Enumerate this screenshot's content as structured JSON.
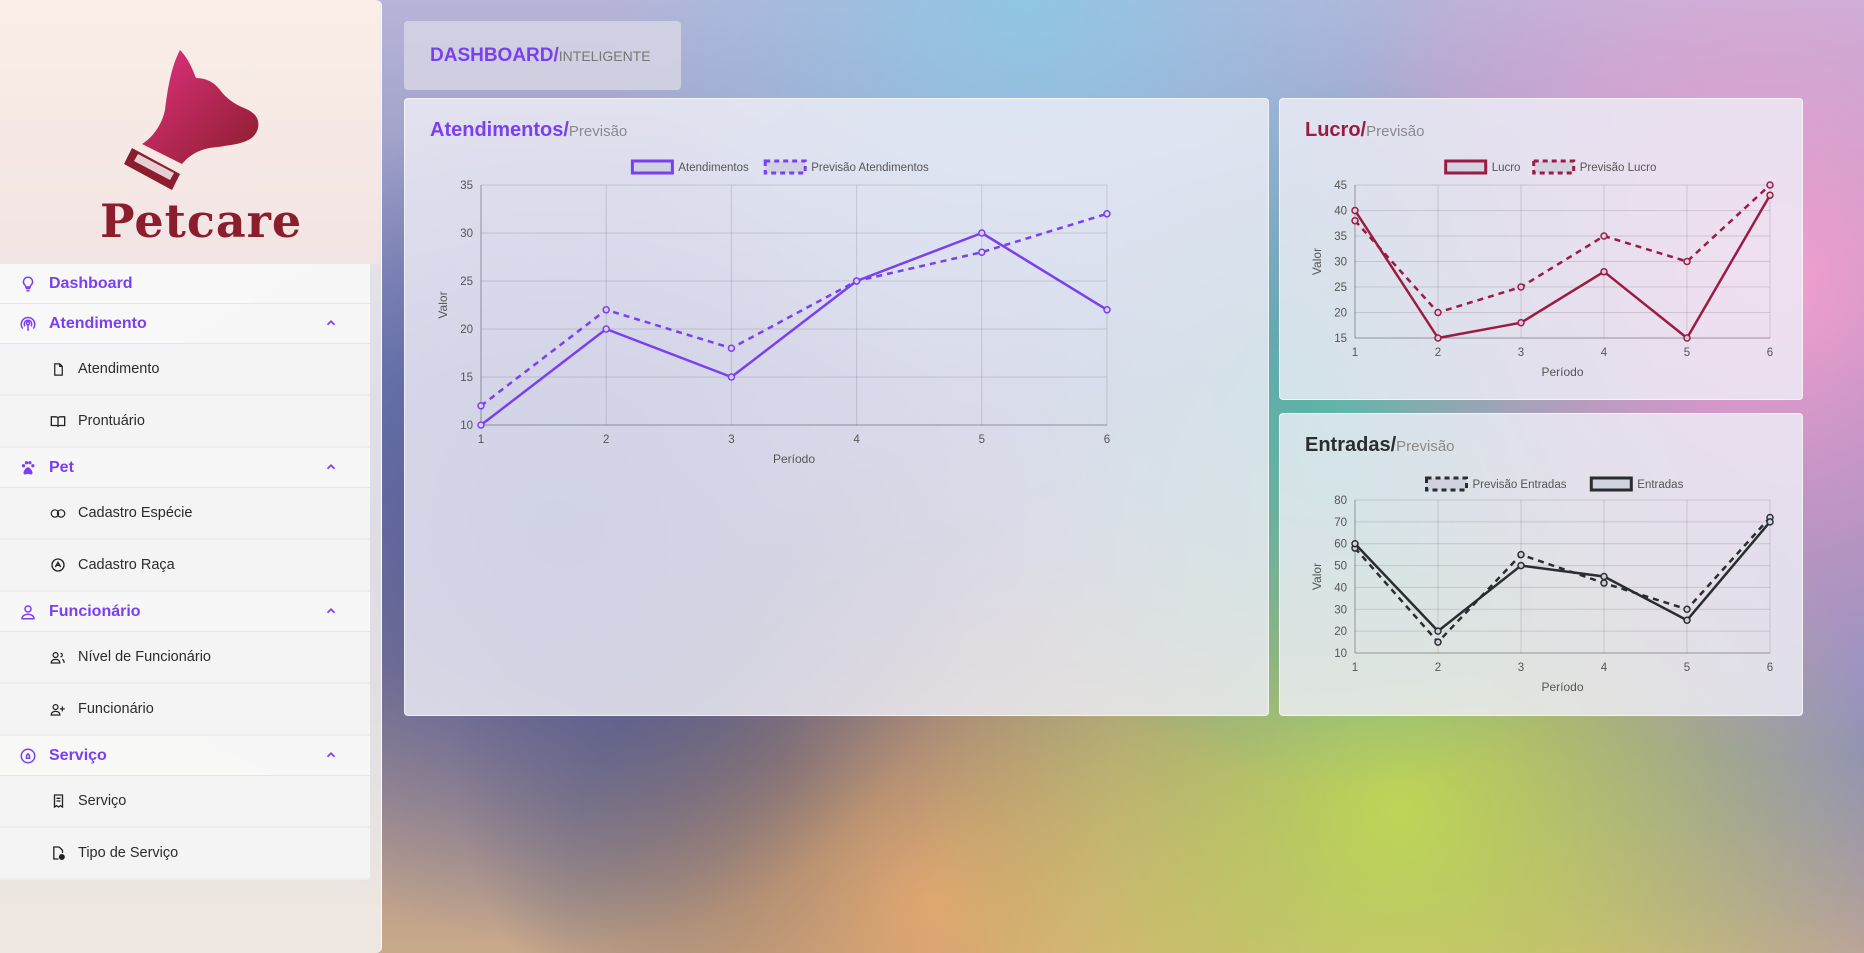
{
  "app": {
    "brand": "Petcare"
  },
  "header": {
    "title_strong": "DASHBOARD/",
    "title_light": "INTELIGENTE"
  },
  "sidebar": {
    "sections": [
      {
        "label": "Dashboard",
        "icon": "lightbulb-icon",
        "expandable": false,
        "items": []
      },
      {
        "label": "Atendimento",
        "icon": "broadcast-icon",
        "expandable": true,
        "items": [
          {
            "label": "Atendimento",
            "icon": "file-icon"
          },
          {
            "label": "Prontuário",
            "icon": "book-icon"
          }
        ]
      },
      {
        "label": "Pet",
        "icon": "paw-icon",
        "expandable": true,
        "items": [
          {
            "label": "Cadastro Espécie",
            "icon": "circles-icon"
          },
          {
            "label": "Cadastro Raça",
            "icon": "badge-icon"
          }
        ]
      },
      {
        "label": "Funcionário",
        "icon": "person-icon",
        "expandable": true,
        "items": [
          {
            "label": "Nível de Funcionário",
            "icon": "people-icon"
          },
          {
            "label": "Funcionário",
            "icon": "person-add-icon"
          }
        ]
      },
      {
        "label": "Serviço",
        "icon": "bell-circle-icon",
        "expandable": true,
        "items": [
          {
            "label": "Serviço",
            "icon": "receipt-icon"
          },
          {
            "label": "Tipo de Serviço",
            "icon": "file-gear-icon"
          }
        ]
      }
    ]
  },
  "colors": {
    "accent_purple": "#7b3ff2",
    "accent_crimson": "#9b1b45",
    "dark": "#2a2d30"
  },
  "cards": {
    "atendimentos": {
      "title_strong": "Atendimentos/",
      "title_light": "Previsão"
    },
    "lucro": {
      "title_strong": "Lucro/",
      "title_light": "Previsão"
    },
    "entradas": {
      "title_strong": "Entradas/",
      "title_light": "Previsão"
    }
  },
  "chart_data": [
    {
      "id": "atendimentos",
      "type": "line",
      "xlabel": "Período",
      "ylabel": "Valor",
      "x": [
        1,
        2,
        3,
        4,
        5,
        6
      ],
      "ylim": [
        10,
        35
      ],
      "yticks": [
        10,
        15,
        20,
        25,
        30,
        35
      ],
      "grid": true,
      "legend": "top-center",
      "color": "#7b3ff2",
      "series": [
        {
          "name": "Atendimentos",
          "dashed": false,
          "values": [
            10,
            20,
            15,
            25,
            30,
            22
          ]
        },
        {
          "name": "Previsão Atendimentos",
          "dashed": true,
          "values": [
            12,
            22,
            18,
            25,
            28,
            32
          ]
        }
      ]
    },
    {
      "id": "lucro",
      "type": "line",
      "xlabel": "Período",
      "ylabel": "Valor",
      "x": [
        1,
        2,
        3,
        4,
        5,
        6
      ],
      "ylim": [
        15,
        45
      ],
      "yticks": [
        15,
        20,
        25,
        30,
        35,
        40,
        45
      ],
      "grid": true,
      "legend": "top-center",
      "color": "#9b1b45",
      "series": [
        {
          "name": "Lucro",
          "dashed": false,
          "values": [
            40,
            15,
            18,
            28,
            15,
            43
          ]
        },
        {
          "name": "Previsão Lucro",
          "dashed": true,
          "values": [
            38,
            20,
            25,
            35,
            30,
            45
          ]
        }
      ]
    },
    {
      "id": "entradas",
      "type": "line",
      "xlabel": "Período",
      "ylabel": "Valor",
      "x": [
        1,
        2,
        3,
        4,
        5,
        6
      ],
      "ylim": [
        10,
        80
      ],
      "yticks": [
        10,
        20,
        30,
        40,
        50,
        60,
        70,
        80
      ],
      "grid": true,
      "legend": "top-center",
      "color": "#2a2d30",
      "series": [
        {
          "name": "Previsão Entradas",
          "dashed": true,
          "values": [
            58,
            15,
            55,
            42,
            30,
            72
          ]
        },
        {
          "name": "Entradas",
          "dashed": false,
          "values": [
            60,
            20,
            50,
            45,
            25,
            70
          ]
        }
      ]
    }
  ]
}
